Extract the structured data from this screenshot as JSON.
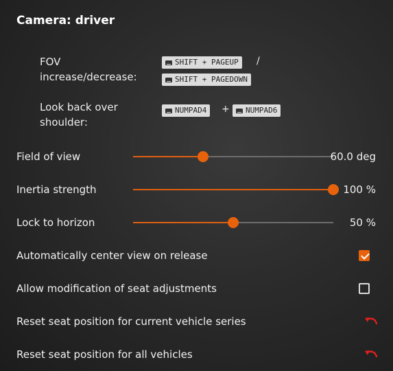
{
  "panel": {
    "title": "Camera: driver"
  },
  "keybinds": {
    "fov": {
      "label_line1": "FOV",
      "label_line2": "increase/decrease:",
      "key1": "SHIFT + PAGEUP",
      "separator": "/",
      "key2": "SHIFT + PAGEDOWN"
    },
    "look_back": {
      "label_line1": "Look back over",
      "label_line2": "shoulder:",
      "key1": "NUMPAD4",
      "separator": "+",
      "key2": "NUMPAD6"
    }
  },
  "sliders": [
    {
      "label": "Field of view",
      "value_text": "60.0 deg",
      "fraction": 0.35
    },
    {
      "label": "Inertia strength",
      "value_text": "100 %",
      "fraction": 1.0
    },
    {
      "label": "Lock to horizon",
      "value_text": "50 %",
      "fraction": 0.5
    }
  ],
  "checkboxes": [
    {
      "label": "Automatically center view on release",
      "checked": true
    },
    {
      "label": "Allow modification of seat adjustments",
      "checked": false
    }
  ],
  "resets": [
    {
      "label": "Reset seat position for current vehicle series",
      "icon": "undo-icon"
    },
    {
      "label": "Reset seat position for all vehicles",
      "icon": "undo-icon"
    }
  ],
  "colors": {
    "accent": "#e8620c",
    "reset_icon": "#e02020",
    "track": "#6d6d6d"
  }
}
